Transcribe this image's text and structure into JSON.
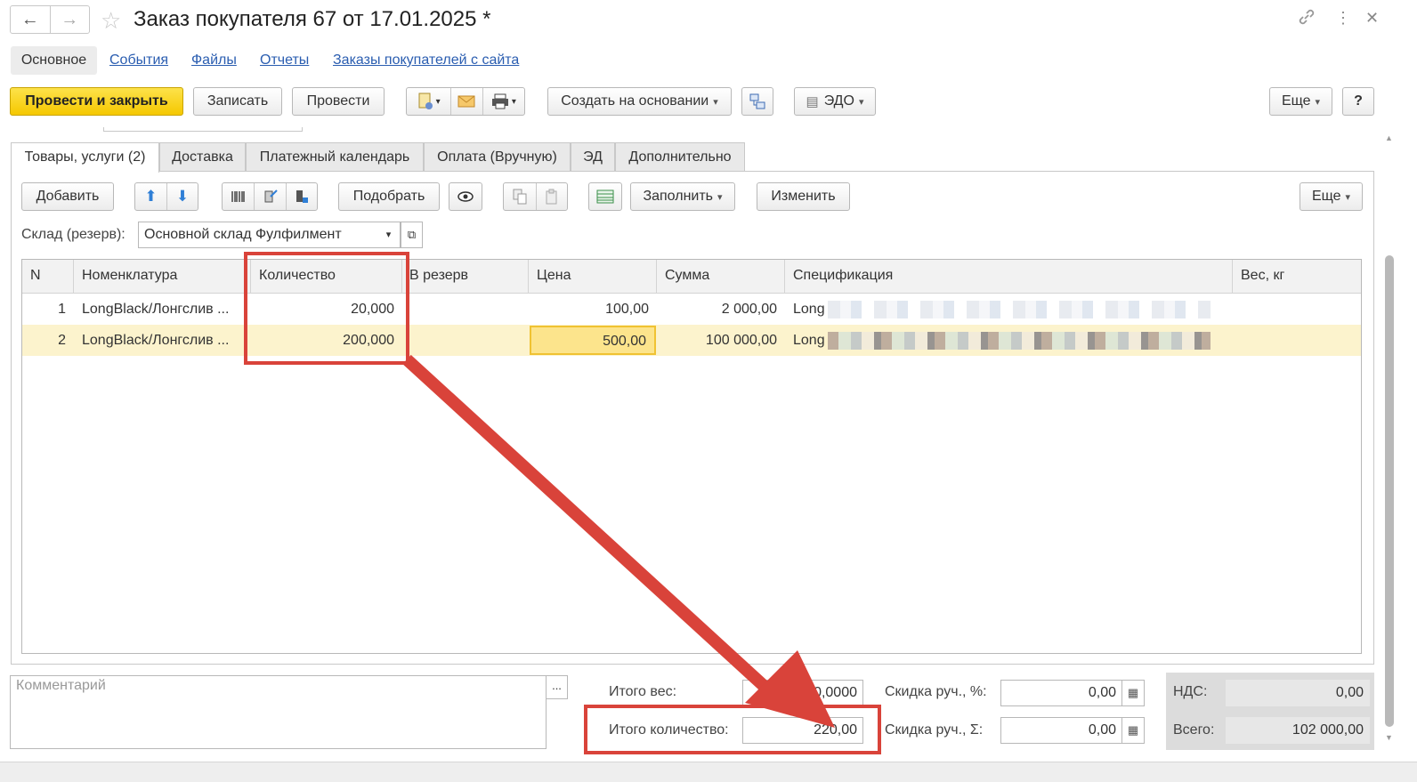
{
  "window": {
    "title": "Заказ покупателя 67 от 17.01.2025 *",
    "back_icon": "←",
    "forward_icon": "→",
    "favorite_icon": "☆",
    "link_icon": "🔗",
    "more_icon": "⋮",
    "close_icon": "✕"
  },
  "page_tabs": [
    "Основное",
    "События",
    "Файлы",
    "Отчеты",
    "Заказы покупателей с сайта"
  ],
  "command_bar": {
    "post_close": "Провести и закрыть",
    "save": "Записать",
    "post": "Провести",
    "create_based": "Создать на основании",
    "edo": "ЭДО",
    "more": "Еще",
    "help": "?"
  },
  "doc_tabs": [
    "Товары, услуги (2)",
    "Доставка",
    "Платежный календарь",
    "Оплата (Вручную)",
    "ЭД",
    "Дополнительно"
  ],
  "goods_toolbar": {
    "add": "Добавить",
    "pick": "Подобрать",
    "fill": "Заполнить",
    "change": "Изменить",
    "more": "Еще"
  },
  "warehouse": {
    "label": "Склад (резерв):",
    "value": "Основной склад Фулфилмент"
  },
  "table": {
    "columns": [
      "N",
      "Номенклатура",
      "Количество",
      "В резерв",
      "Цена",
      "Сумма",
      "Спецификация",
      "Вес, кг"
    ],
    "rows": [
      {
        "n": "1",
        "item": "LongBlack/Лонгслив ...",
        "qty": "20,000",
        "reserve": "",
        "price": "100,00",
        "sum": "2 000,00",
        "spec": "Long",
        "weight": ""
      },
      {
        "n": "2",
        "item": "LongBlack/Лонгслив ...",
        "qty": "200,000",
        "reserve": "",
        "price": "500,00",
        "sum": "100 000,00",
        "spec": "Long",
        "weight": ""
      }
    ]
  },
  "bottom": {
    "comment_placeholder": "Комментарий",
    "comment_button": "...",
    "total_weight_label": "Итого вес:",
    "total_weight": "0,0000",
    "total_qty_label": "Итого количество:",
    "total_qty": "220,00",
    "discount_pct_label": "Скидка руч., %:",
    "discount_pct": "0,00",
    "discount_sum_label": "Скидка руч., Σ:",
    "discount_sum": "0,00",
    "vat_label": "НДС:",
    "vat": "0,00",
    "total_label": "Всего:",
    "total": "102 000,00"
  },
  "colors": {
    "primary_button": "#f5c800",
    "link": "#2a5db0",
    "selected_row": "#fcf3cd",
    "annotation": "#d9433a"
  }
}
